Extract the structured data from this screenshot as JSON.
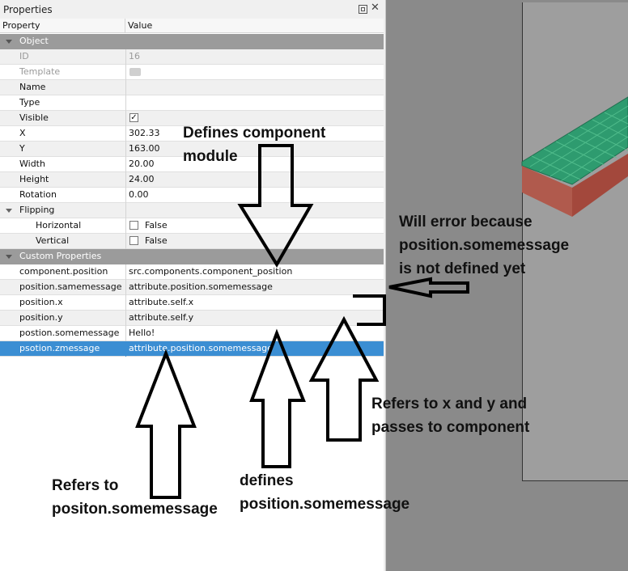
{
  "panel": {
    "title": "Properties",
    "header_property": "Property",
    "header_value": "Value"
  },
  "object_group": {
    "label": "Object",
    "rows": [
      {
        "name": "ID",
        "value": "16"
      },
      {
        "name": "Template",
        "value": ""
      },
      {
        "name": "Name",
        "value": ""
      },
      {
        "name": "Type",
        "value": ""
      },
      {
        "name": "Visible",
        "value": "✓"
      },
      {
        "name": "X",
        "value": "302.33"
      },
      {
        "name": "Y",
        "value": "163.00"
      },
      {
        "name": "Width",
        "value": "20.00"
      },
      {
        "name": "Height",
        "value": "24.00"
      },
      {
        "name": "Rotation",
        "value": "0.00"
      }
    ]
  },
  "flipping": {
    "label": "Flipping",
    "horizontal": {
      "name": "Horizontal",
      "value": "False"
    },
    "vertical": {
      "name": "Vertical",
      "value": "False"
    }
  },
  "custom_group": {
    "label": "Custom Properties",
    "rows": [
      {
        "name": "component.position",
        "value": "src.components.component_position"
      },
      {
        "name": "position.samemessage",
        "value": "attribute.position.somemessage"
      },
      {
        "name": "position.x",
        "value": "attribute.self.x"
      },
      {
        "name": "position.y",
        "value": "attribute.self.y"
      },
      {
        "name": "postion.somemessage",
        "value": "Hello!"
      },
      {
        "name": "psotion.zmessage",
        "value": "attribute.position.somemessage"
      }
    ]
  },
  "annotations": {
    "defines_component": "Defines component\nmodule",
    "will_error": "Will error because\nposition.somemessage\nis not defined yet",
    "refers_xy": "Refers to x and y and\npasses to component",
    "refers_to": "Refers to\npositon.somemessage",
    "defines_pos": "defines\nposition.somemessage"
  },
  "colors": {
    "selection": "#3b8ed3",
    "group_header": "#9b9b9b",
    "scene_bg": "#8a8a8a",
    "grid_green": "#2e9b6f"
  }
}
